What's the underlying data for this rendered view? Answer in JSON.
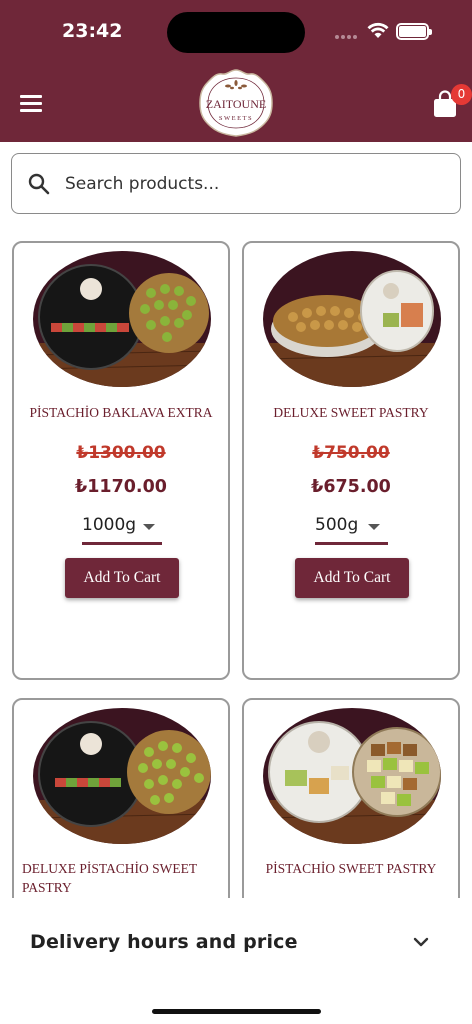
{
  "status_bar": {
    "time": "23:42"
  },
  "header": {
    "logo_text": "ZAITOUNE",
    "logo_subtext": "SWEETS",
    "cart_count": "0",
    "brand_color": "#6f2739"
  },
  "search": {
    "placeholder": "Search products..."
  },
  "products": [
    {
      "name": "PİSTACHİO BAKLAVA EXTRA",
      "old_price": "₺1300.00",
      "new_price": "₺1170.00",
      "weight": "1000g",
      "button": "Add To Cart"
    },
    {
      "name": "DELUXE SWEET PASTRY",
      "old_price": "₺750.00",
      "new_price": "₺675.00",
      "weight": "500g",
      "button": "Add To Cart"
    },
    {
      "name": "DELUXE PİSTACHİO SWEET PASTRY"
    },
    {
      "name": "PİSTACHİO SWEET PASTRY"
    }
  ],
  "delivery": {
    "title": "Delivery hours and price"
  }
}
